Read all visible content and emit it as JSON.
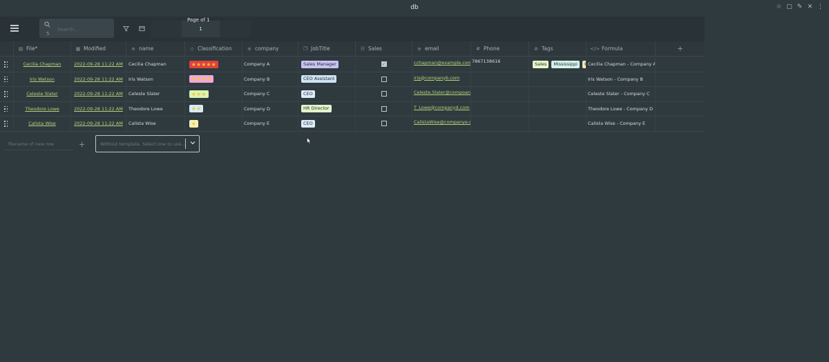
{
  "window": {
    "title": "db"
  },
  "toolbar": {
    "search_placeholder": "Search...",
    "search_count": "5",
    "page_label": "Page of 1",
    "page_value": "1"
  },
  "columns": [
    {
      "icon": "file-icon",
      "glyph": "▤",
      "label": "File*"
    },
    {
      "icon": "calendar-icon",
      "glyph": "▦",
      "label": "Modified"
    },
    {
      "icon": "text-icon",
      "glyph": "≡",
      "label": "name"
    },
    {
      "icon": "tag-icon",
      "glyph": "◇",
      "label": "Classification"
    },
    {
      "icon": "text-icon",
      "glyph": "≡",
      "label": "company"
    },
    {
      "icon": "copy-icon",
      "glyph": "❐",
      "label": "JobTitle"
    },
    {
      "icon": "checklist-icon",
      "glyph": "☷",
      "label": "Sales"
    },
    {
      "icon": "text-icon",
      "glyph": "≡",
      "label": "email"
    },
    {
      "icon": "hash-icon",
      "glyph": "#",
      "label": "Phone"
    },
    {
      "icon": "tags-icon",
      "glyph": "⊘",
      "label": "Tags"
    },
    {
      "icon": "code-icon",
      "glyph": "</>",
      "label": "Formula"
    }
  ],
  "rows": [
    {
      "file": "Cecilia Chapman",
      "modified": "2022-09-28 11:22 AM",
      "name": "Cecilia Chapman",
      "stars": "★★★★★",
      "star_count": 5,
      "star_bg": "#e04040",
      "company": "Company A",
      "job": "Sales Manager",
      "job_bg": "#c9c3f2",
      "sales": true,
      "email": "cchapman@example.com",
      "phone": "7867138616",
      "formula": "Cecilia Chapman - Company A"
    },
    {
      "file": "Iris Watson",
      "modified": "2022-09-28 11:22 AM",
      "name": "Iris Watson",
      "stars": "★★★★",
      "star_count": 4,
      "star_bg": "#f0a8d6",
      "company": "Company B",
      "job": "CEO Assistant",
      "job_bg": "#cfe3f5",
      "sales": false,
      "email": "iris@companyb.com",
      "phone": "",
      "formula": "Iris Watson - Company B"
    },
    {
      "file": "Celeste Slater",
      "modified": "2022-09-28 11:22 AM",
      "name": "Celeste Slater",
      "stars": "★★★",
      "star_count": 3,
      "star_bg": "#d9f2b4",
      "company": "Company C",
      "job": "CEO",
      "job_bg": "#dcebfa",
      "sales": false,
      "email": "Celeste.Slater@compoanyc.c",
      "phone": "",
      "formula": "Celeste Slater - Company C"
    },
    {
      "file": "Theodore Lowe",
      "modified": "2022-09-28 11:22 AM",
      "name": "Theodore Lowe",
      "stars": "★★",
      "star_count": 2,
      "star_bg": "#d4ecf8",
      "company": "Company D",
      "job": "HR Director",
      "job_bg": "#e4f5cc",
      "sales": false,
      "email": "T_Lowe@companyd.com",
      "phone": "",
      "formula": "Theodore Lowe - Company D"
    },
    {
      "file": "Calista Wise",
      "modified": "2022-09-28 11:22 AM",
      "name": "Calista Wise",
      "stars": "★",
      "star_count": 1,
      "star_bg": "#f6f0b8",
      "company": "Company E",
      "job": "CEO",
      "job_bg": "#dcebfa",
      "sales": false,
      "email": "CalistaWise@companye.com",
      "phone": "",
      "formula": "Calista Wise - Company E"
    }
  ],
  "row0_tags": [
    {
      "label": "Sales",
      "bg": "#e9f5c8"
    },
    {
      "label": "Mississippi",
      "bg": "#d4f1ea"
    },
    {
      "label": "Cali",
      "bg": "#f7e6b4"
    }
  ],
  "footer": {
    "new_row_placeholder": "filename of new row",
    "template_placeholder": "Without template. Select one to use..."
  }
}
